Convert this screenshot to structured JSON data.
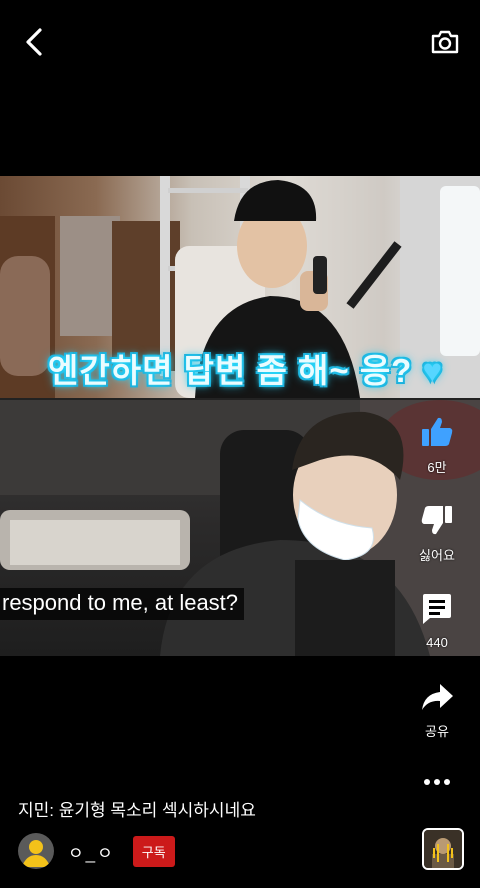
{
  "video": {
    "caption_korean": "엔간하면 답변 좀 해~ 응?",
    "caption_heart": "♥",
    "caption_english": "respond to me, at least?"
  },
  "actions": {
    "like_count": "6만",
    "dislike_label": "싫어요",
    "comment_count": "440",
    "share_label": "공유"
  },
  "post": {
    "title": "지민: 윤기형 목소리 섹시하시네요"
  },
  "channel": {
    "name": "ㅇ_ㅇ",
    "subscribe_label": "구독"
  },
  "colors": {
    "subscribe_red": "#cc1a1a",
    "like_blue": "#3fa1ff",
    "caption_glow": "#2de0ff"
  },
  "icons": [
    "back-icon",
    "camera-icon",
    "thumbs-up-icon",
    "thumbs-down-icon",
    "comment-icon",
    "share-icon",
    "more-icon",
    "avatar-icon",
    "sound-icon"
  ]
}
